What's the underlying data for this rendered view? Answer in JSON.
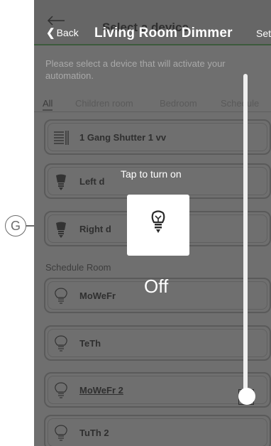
{
  "header": {
    "back_label": "Back",
    "overlay_title": "Select a device",
    "title": "Living Room Dimmer",
    "set_label": "Set"
  },
  "instruction": "Please select a device that will activate your automation.",
  "tabs": [
    "All",
    "Children room",
    "Bedroom",
    "Schedule"
  ],
  "devices": [
    {
      "label": "1 Gang Shutter 1 vv",
      "icon": "shutter-icon"
    },
    {
      "label": "Left d",
      "icon": "bulb-icon"
    },
    {
      "label": "Right d",
      "icon": "bulb-icon"
    },
    {
      "label": "MoWeFr",
      "icon": "bulb-outline-icon"
    },
    {
      "label": "TeTh",
      "icon": "bulb-outline-icon"
    },
    {
      "label": "MoWeFr 2",
      "icon": "bulb-outline-icon"
    },
    {
      "label": "TuTh 2",
      "icon": "bulb-outline-icon"
    }
  ],
  "section_label": "Schedule Room",
  "popup": {
    "hint": "Tap to turn on",
    "icon": "bulb-icon",
    "state": "Off"
  },
  "dimmer_level": 0,
  "callout": "G",
  "colors": {
    "overlay": "#6f6f6f",
    "popup": "#ffffff",
    "slider": "#efefef"
  }
}
